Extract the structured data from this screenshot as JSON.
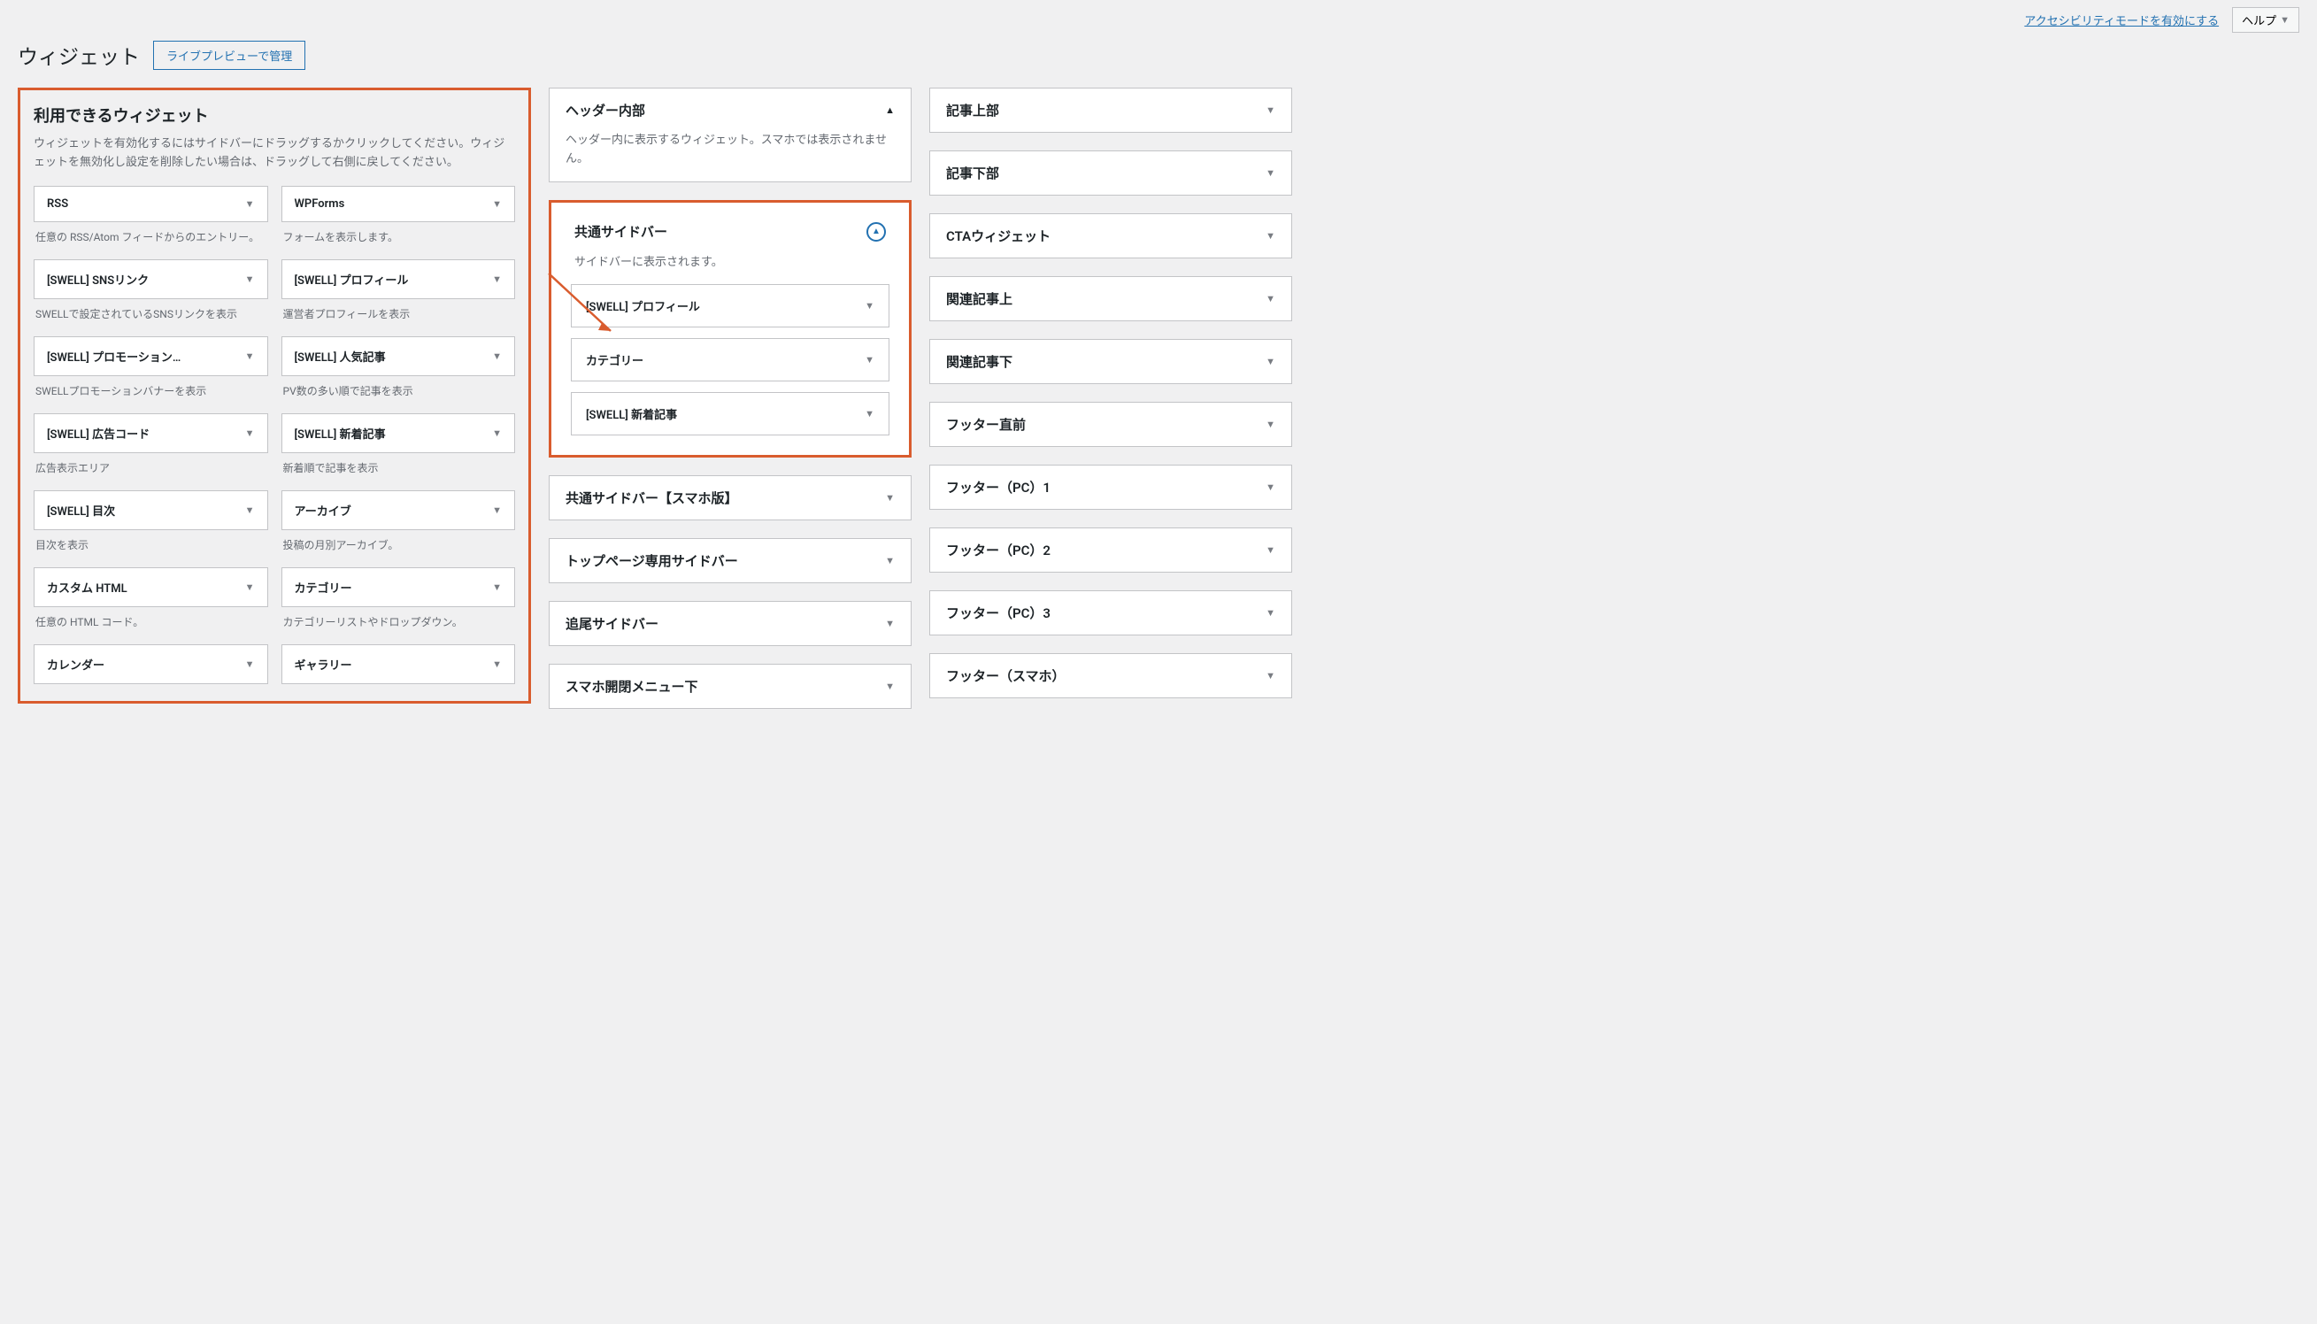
{
  "topBar": {
    "accessibilityLink": "アクセシビリティモードを有効にする",
    "helpLabel": "ヘルプ"
  },
  "header": {
    "title": "ウィジェット",
    "livePreviewBtn": "ライブプレビューで管理"
  },
  "available": {
    "title": "利用できるウィジェット",
    "desc": "ウィジェットを有効化するにはサイドバーにドラッグするかクリックしてください。ウィジェットを無効化し設定を削除したい場合は、ドラッグして右側に戻してください。",
    "rows": [
      [
        {
          "label": "RSS",
          "desc": "任意の RSS/Atom フィードからのエントリー。"
        },
        {
          "label": "WPForms",
          "desc": "フォームを表示します。"
        }
      ],
      [
        {
          "label": "[SWELL] SNSリンク",
          "desc": "SWELLで設定されているSNSリンクを表示"
        },
        {
          "label": "[SWELL] プロフィール",
          "desc": "運営者プロフィールを表示"
        }
      ],
      [
        {
          "label": "[SWELL] プロモーション…",
          "desc": "SWELLプロモーションバナーを表示"
        },
        {
          "label": "[SWELL] 人気記事",
          "desc": "PV数の多い順で記事を表示"
        }
      ],
      [
        {
          "label": "[SWELL] 広告コード",
          "desc": "広告表示エリア"
        },
        {
          "label": "[SWELL] 新着記事",
          "desc": "新着順で記事を表示"
        }
      ],
      [
        {
          "label": "[SWELL] 目次",
          "desc": "目次を表示"
        },
        {
          "label": "アーカイブ",
          "desc": "投稿の月別アーカイブ。"
        }
      ],
      [
        {
          "label": "カスタム HTML",
          "desc": "任意の HTML コード。"
        },
        {
          "label": "カテゴリー",
          "desc": "カテゴリーリストやドロップダウン。"
        }
      ],
      [
        {
          "label": "カレンダー",
          "desc": ""
        },
        {
          "label": "ギャラリー",
          "desc": ""
        }
      ]
    ]
  },
  "middleAreas": {
    "header": {
      "title": "ヘッダー内部",
      "desc": "ヘッダー内に表示するウィジェット。スマホでは表示されません。"
    },
    "commonSidebar": {
      "title": "共通サイドバー",
      "desc": "サイドバーに表示されます。",
      "items": [
        {
          "label": "[SWELL] プロフィール"
        },
        {
          "label": "カテゴリー"
        },
        {
          "label": "[SWELL] 新着記事"
        }
      ]
    },
    "collapsed": [
      {
        "label": "共通サイドバー【スマホ版】"
      },
      {
        "label": "トップページ専用サイドバー"
      },
      {
        "label": "追尾サイドバー"
      },
      {
        "label": "スマホ開閉メニュー下"
      }
    ]
  },
  "rightAreas": [
    {
      "label": "記事上部"
    },
    {
      "label": "記事下部"
    },
    {
      "label": "CTAウィジェット"
    },
    {
      "label": "関連記事上"
    },
    {
      "label": "関連記事下"
    },
    {
      "label": "フッター直前"
    },
    {
      "label": "フッター（PC）1"
    },
    {
      "label": "フッター（PC）2"
    },
    {
      "label": "フッター（PC）3"
    },
    {
      "label": "フッター（スマホ）"
    }
  ]
}
